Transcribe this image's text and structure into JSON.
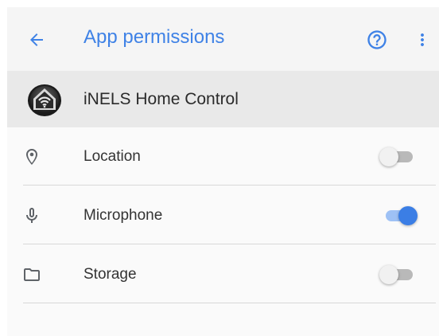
{
  "colors": {
    "accent": "#3f82e6",
    "toggle_on": "#3b7ee5",
    "toggle_off": "#f1f1f1"
  },
  "toolbar": {
    "back_icon": "arrow-back-icon",
    "title": "App permissions",
    "help_icon": "help-circle-icon",
    "more_icon": "more-vert-icon"
  },
  "app": {
    "icon": "app-logo-icon",
    "name": "iNELS Home Control"
  },
  "permissions": [
    {
      "label": "Location",
      "icon": "location-pin-icon",
      "enabled": false
    },
    {
      "label": "Microphone",
      "icon": "microphone-icon",
      "enabled": true
    },
    {
      "label": "Storage",
      "icon": "folder-icon",
      "enabled": false
    }
  ]
}
